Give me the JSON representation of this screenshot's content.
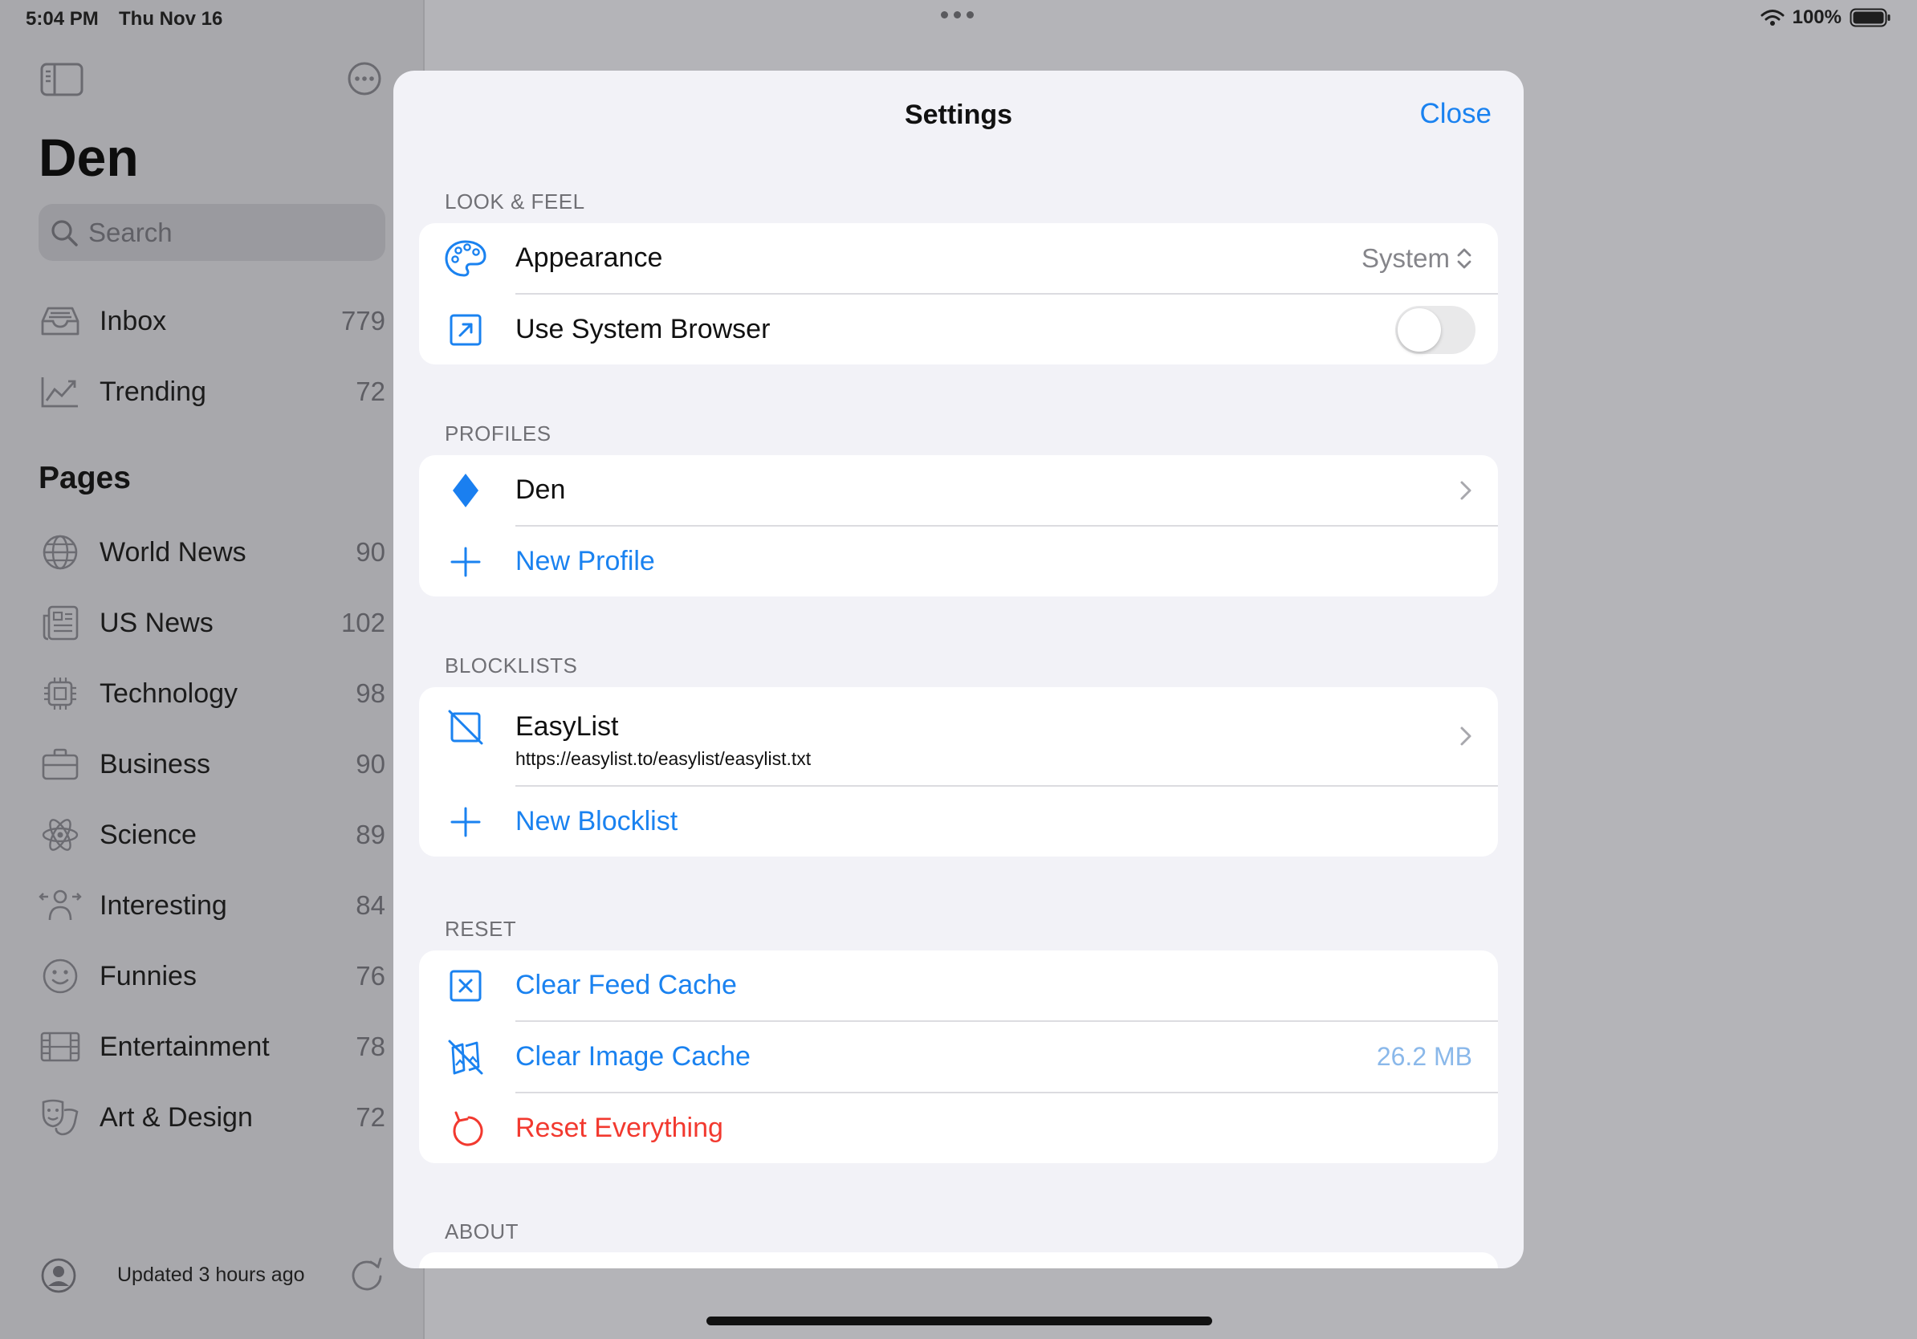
{
  "status_bar": {
    "time": "5:04 PM",
    "date": "Thu Nov 16",
    "battery": "100%"
  },
  "sidebar": {
    "title": "Den",
    "search_placeholder": "Search",
    "top_items": [
      {
        "label": "Inbox",
        "count": "779",
        "icon": "inbox-icon"
      },
      {
        "label": "Trending",
        "count": "72",
        "icon": "trending-icon"
      }
    ],
    "pages_header": "Pages",
    "pages": [
      {
        "label": "World News",
        "count": "90",
        "icon": "globe-icon"
      },
      {
        "label": "US News",
        "count": "102",
        "icon": "newspaper-icon"
      },
      {
        "label": "Technology",
        "count": "98",
        "icon": "cpu-icon"
      },
      {
        "label": "Business",
        "count": "90",
        "icon": "briefcase-icon"
      },
      {
        "label": "Science",
        "count": "89",
        "icon": "atom-icon"
      },
      {
        "label": "Interesting",
        "count": "84",
        "icon": "person-arrows-icon"
      },
      {
        "label": "Funnies",
        "count": "76",
        "icon": "smiley-icon"
      },
      {
        "label": "Entertainment",
        "count": "78",
        "icon": "film-icon"
      },
      {
        "label": "Art & Design",
        "count": "72",
        "icon": "theater-masks-icon"
      }
    ],
    "footer_text": "Updated 3 hours ago"
  },
  "settings": {
    "title": "Settings",
    "close_label": "Close",
    "look_and_feel": {
      "header": "LOOK & FEEL",
      "appearance_label": "Appearance",
      "appearance_value": "System",
      "system_browser_label": "Use System Browser",
      "system_browser_enabled": false
    },
    "profiles": {
      "header": "PROFILES",
      "profile_name": "Den",
      "new_profile_label": "New Profile"
    },
    "blocklists": {
      "header": "BLOCKLISTS",
      "list_name": "EasyList",
      "list_url": "https://easylist.to/easylist/easylist.txt",
      "new_blocklist_label": "New Blocklist"
    },
    "reset": {
      "header": "RESET",
      "clear_feed_label": "Clear Feed Cache",
      "clear_image_label": "Clear Image Cache",
      "image_cache_size": "26.2 MB",
      "reset_everything_label": "Reset Everything"
    },
    "about": {
      "header": "ABOUT"
    }
  },
  "colors": {
    "accent": "#1a82f0",
    "destructive": "#f2392f",
    "diamond": "#1a7ff0"
  }
}
